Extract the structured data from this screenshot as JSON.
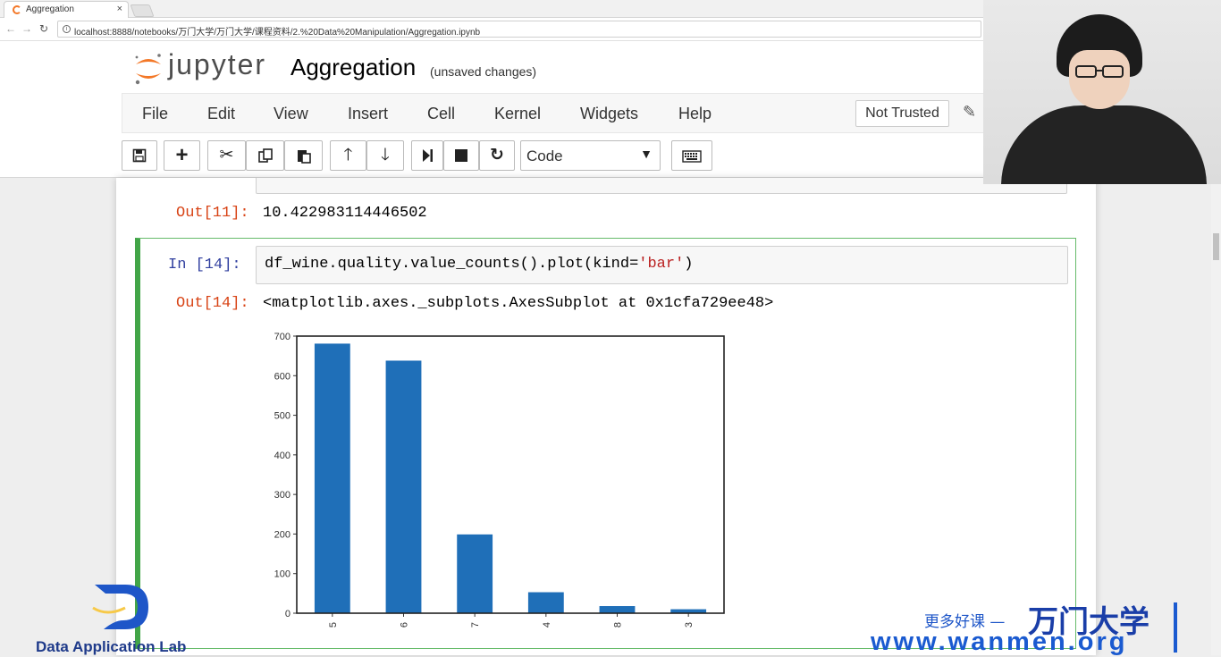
{
  "browser": {
    "tab_title": "Aggregation",
    "tab_close": "×",
    "url": "localhost:8888/notebooks/万门大学/万门大学/课程资料/2.%20Data%20Manipulation/Aggregation.ipynb"
  },
  "jupyter": {
    "logo_text": "jupyter",
    "notebook_name": "Aggregation",
    "save_status": "(unsaved changes)",
    "menu": [
      "File",
      "Edit",
      "View",
      "Insert",
      "Cell",
      "Kernel",
      "Widgets",
      "Help"
    ],
    "trusted_label": "Not Trusted",
    "cell_type": "Code",
    "toolbar_icons": [
      "save-icon",
      "plus-icon",
      "scissors-icon",
      "copy-icon",
      "paste-icon",
      "arrow-up-icon",
      "arrow-down-icon",
      "step-forward-icon",
      "stop-icon",
      "restart-icon",
      "keyboard-icon"
    ]
  },
  "cells": {
    "prev_out_prompt": "Out[11]:",
    "prev_out_value": "10.422983114446502",
    "in_prompt": "In  [14]:",
    "code_prefix": "df_wine.quality.value_counts().plot(kind=",
    "code_string": "'bar'",
    "code_suffix": ")",
    "out_prompt": "Out[14]:",
    "out_repr": "<matplotlib.axes._subplots.AxesSubplot at 0x1cfa729ee48>"
  },
  "chart_data": {
    "type": "bar",
    "categories": [
      "5",
      "6",
      "7",
      "4",
      "8",
      "3"
    ],
    "values": [
      681,
      638,
      199,
      53,
      18,
      10
    ],
    "ylim": [
      0,
      700
    ],
    "yticks": [
      0,
      100,
      200,
      300,
      400,
      500,
      600,
      700
    ],
    "bar_color": "#1f6fb8",
    "title": "",
    "xlabel": "",
    "ylabel": "",
    "grid": false
  },
  "watermark": {
    "lab_name": "Data Application Lab",
    "cn_slogan": "更多好课 —",
    "cn_brand": "万门大学",
    "url": "www.wanmen.org"
  }
}
